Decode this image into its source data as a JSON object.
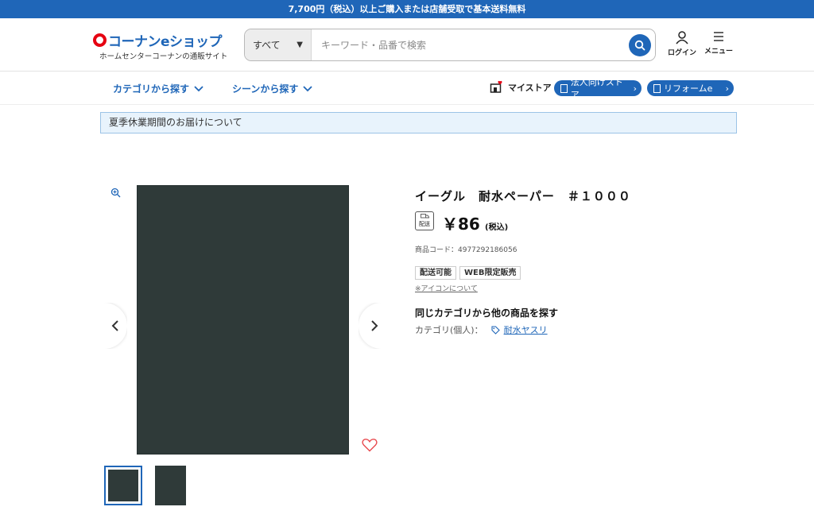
{
  "topbar": {
    "message": "7,700円（税込）以上ご購入または店舗受取で基本送料無料"
  },
  "header": {
    "logo_text": "コーナンeショップ",
    "logo_sub": "ホームセンターコーナンの通販サイト",
    "search": {
      "category": "すべて",
      "placeholder": "キーワード・品番で検索"
    },
    "login_label": "ログイン",
    "menu_label": "メニュー"
  },
  "nav": {
    "category_label": "カテゴリから探す",
    "scene_label": "シーンから探す",
    "mystore_label": "マイストア",
    "corporate_label": "法人向けストア",
    "reform_label": "リフォームe"
  },
  "notice": {
    "text": "夏季休業期間のお届けについて"
  },
  "product": {
    "title": "イーグル　耐水ペーパー　＃１０００",
    "ship_badge": "配送",
    "price": "￥86",
    "tax_note": "(税込)",
    "code": "商品コード：4977292186056",
    "tags": [
      "配送可能",
      "WEB限定販売"
    ],
    "icon_note": "※アイコンについて",
    "same_category_heading": "同じカテゴリから他の商品を探す",
    "category_prefix": "カテゴリ(個人)：",
    "category_link": "耐水ヤスリ"
  },
  "colors": {
    "brand_blue": "#1f66b8",
    "logo_red": "#e60012",
    "product_dark": "#2f3a39",
    "heart_red": "#e8474c"
  }
}
